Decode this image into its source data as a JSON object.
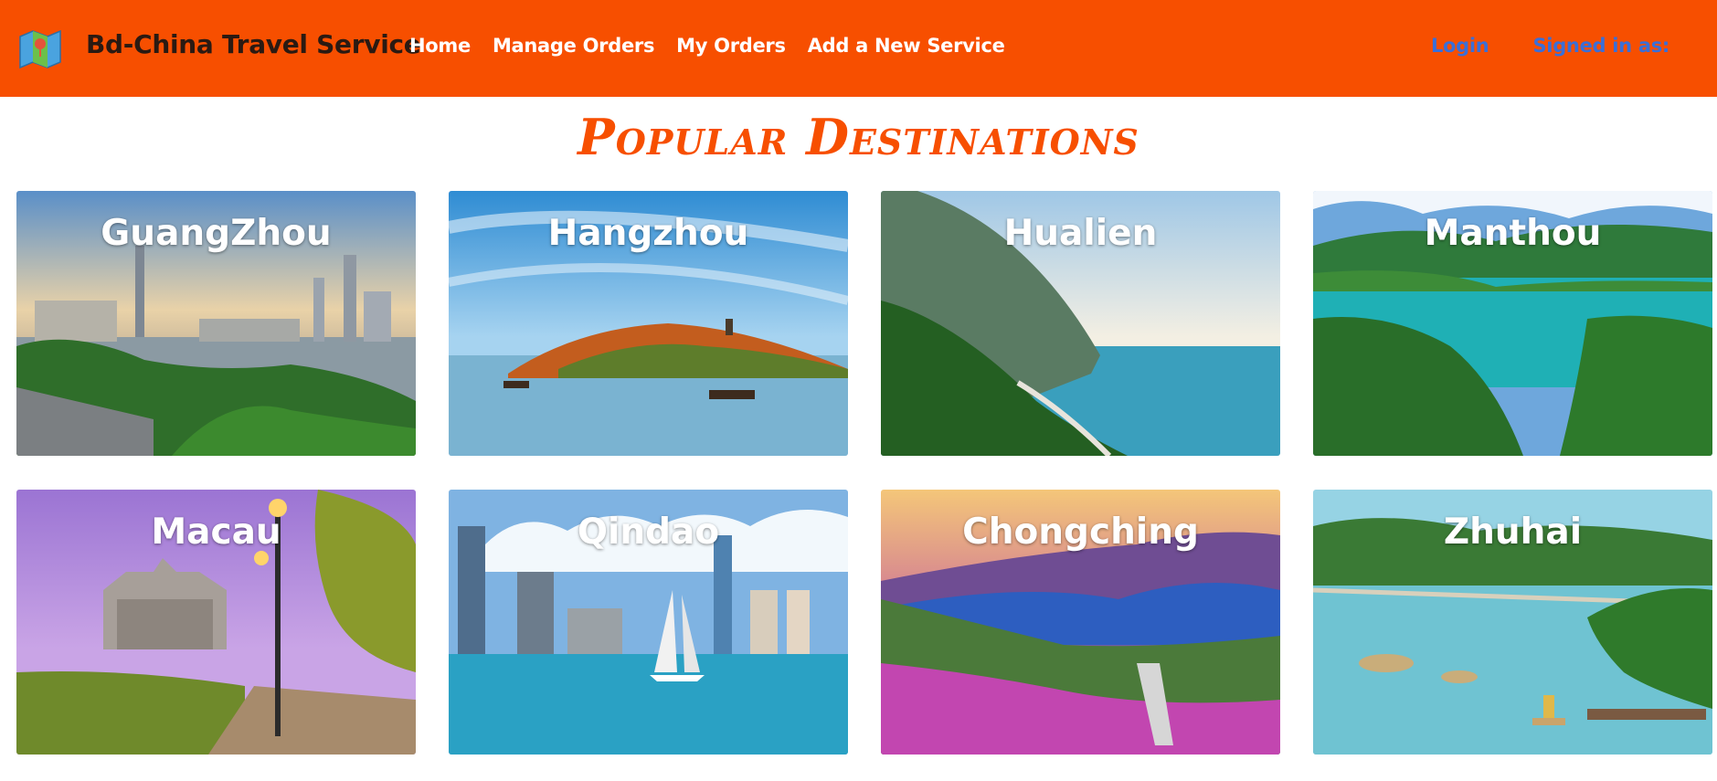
{
  "brand": {
    "title": "Bd-China Travel Service",
    "logo_icon": "map-icon"
  },
  "nav": {
    "links": [
      "Home",
      "Manage Orders",
      "My Orders",
      "Add a New Service"
    ],
    "login": "Login",
    "signed_in": "Signed in as:"
  },
  "colors": {
    "navbar": "#f74f00",
    "title": "#f74f00",
    "auth_links": "#3a6fd8"
  },
  "section": {
    "title": "Popular Destinations"
  },
  "destinations": [
    {
      "name": "GuangZhou"
    },
    {
      "name": "Hangzhou"
    },
    {
      "name": "Hualien"
    },
    {
      "name": "Manthou"
    },
    {
      "name": "Macau"
    },
    {
      "name": "Qindao"
    },
    {
      "name": "Chongching"
    },
    {
      "name": "Zhuhai"
    }
  ]
}
